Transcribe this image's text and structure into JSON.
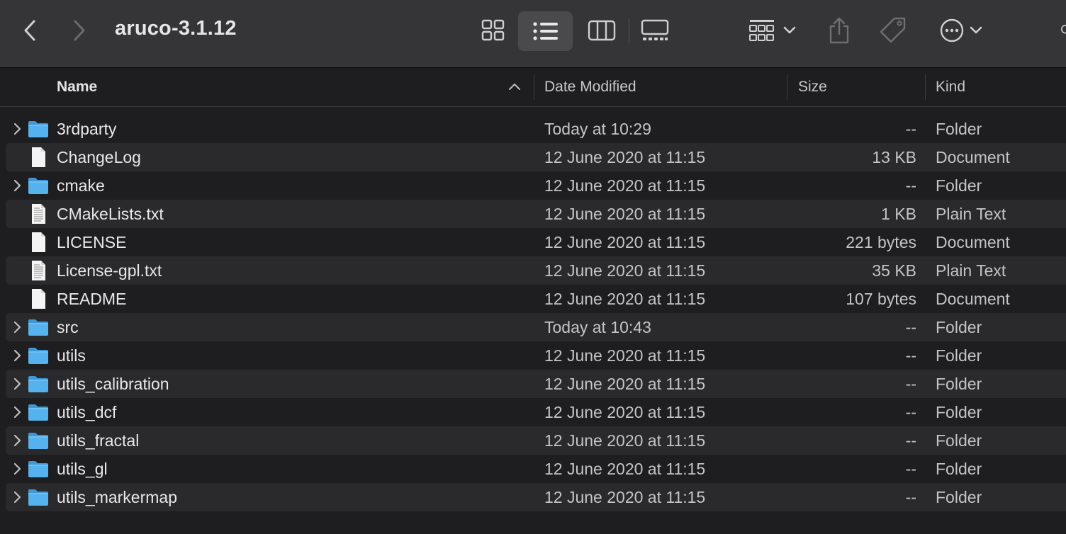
{
  "window": {
    "title": "aruco-3.1.12"
  },
  "columns": {
    "name": "Name",
    "date": "Date Modified",
    "size": "Size",
    "kind": "Kind"
  },
  "icons": {
    "back": "chevron-left-icon",
    "forward": "chevron-right-icon",
    "view_icons": "grid-icon",
    "view_list": "list-icon",
    "view_columns": "columns-icon",
    "view_gallery": "gallery-icon",
    "group": "group-icon",
    "share": "share-icon",
    "tag": "tag-icon",
    "more": "ellipsis-icon",
    "search": "search-icon"
  },
  "colors": {
    "accent_folder": "#4aa8e8",
    "row_alt": "#2a2a2d"
  },
  "files": [
    {
      "name": "3rdparty",
      "date": "Today at 10:29",
      "size": "--",
      "kind": "Folder",
      "type": "folder"
    },
    {
      "name": "ChangeLog",
      "date": "12 June 2020 at 11:15",
      "size": "13 KB",
      "kind": "Document",
      "type": "doc"
    },
    {
      "name": "cmake",
      "date": "12 June 2020 at 11:15",
      "size": "--",
      "kind": "Folder",
      "type": "folder"
    },
    {
      "name": "CMakeLists.txt",
      "date": "12 June 2020 at 11:15",
      "size": "1 KB",
      "kind": "Plain Text",
      "type": "text"
    },
    {
      "name": "LICENSE",
      "date": "12 June 2020 at 11:15",
      "size": "221 bytes",
      "kind": "Document",
      "type": "doc"
    },
    {
      "name": "License-gpl.txt",
      "date": "12 June 2020 at 11:15",
      "size": "35 KB",
      "kind": "Plain Text",
      "type": "text"
    },
    {
      "name": "README",
      "date": "12 June 2020 at 11:15",
      "size": "107 bytes",
      "kind": "Document",
      "type": "doc"
    },
    {
      "name": "src",
      "date": "Today at 10:43",
      "size": "--",
      "kind": "Folder",
      "type": "folder"
    },
    {
      "name": "utils",
      "date": "12 June 2020 at 11:15",
      "size": "--",
      "kind": "Folder",
      "type": "folder"
    },
    {
      "name": "utils_calibration",
      "date": "12 June 2020 at 11:15",
      "size": "--",
      "kind": "Folder",
      "type": "folder"
    },
    {
      "name": "utils_dcf",
      "date": "12 June 2020 at 11:15",
      "size": "--",
      "kind": "Folder",
      "type": "folder"
    },
    {
      "name": "utils_fractal",
      "date": "12 June 2020 at 11:15",
      "size": "--",
      "kind": "Folder",
      "type": "folder"
    },
    {
      "name": "utils_gl",
      "date": "12 June 2020 at 11:15",
      "size": "--",
      "kind": "Folder",
      "type": "folder"
    },
    {
      "name": "utils_markermap",
      "date": "12 June 2020 at 11:15",
      "size": "--",
      "kind": "Folder",
      "type": "folder"
    }
  ]
}
